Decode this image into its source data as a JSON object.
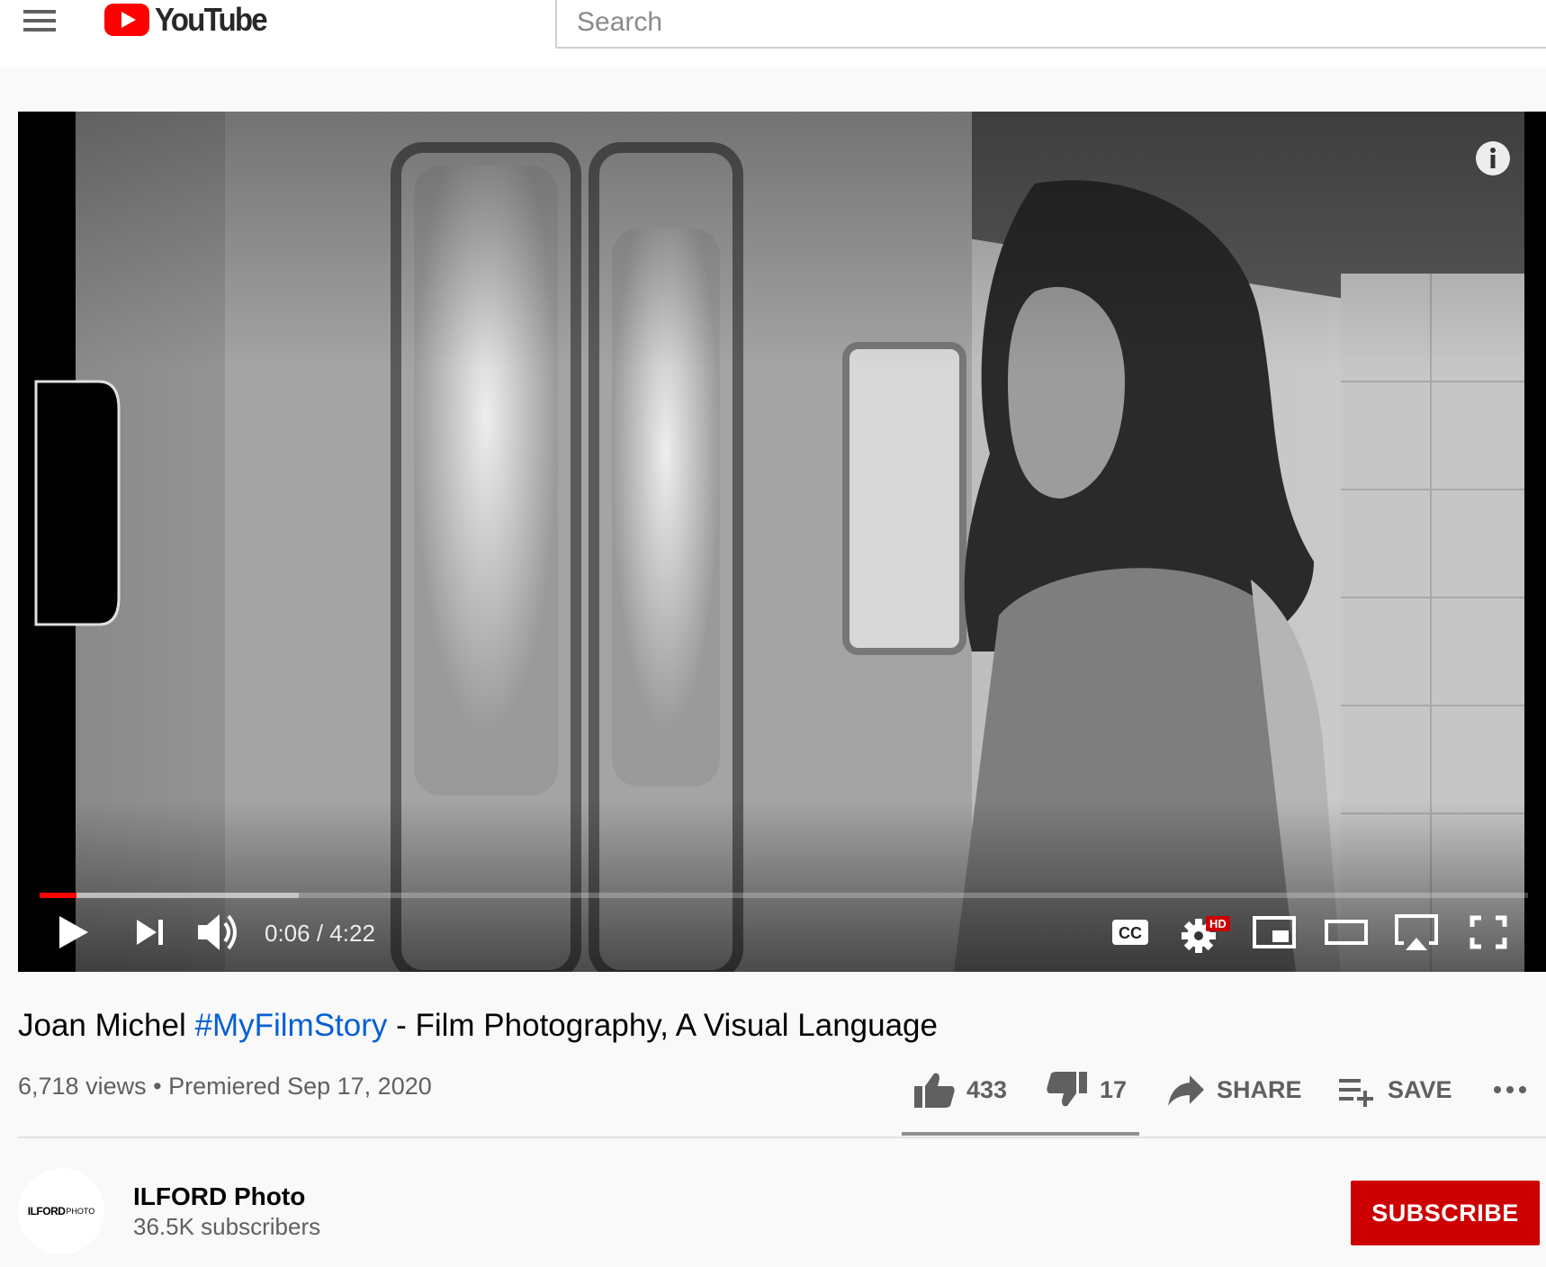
{
  "header": {
    "logo_text": "YouTube",
    "search_placeholder": "Search"
  },
  "player": {
    "current_time": "0:06",
    "duration": "4:22",
    "progress_played": 0.025,
    "progress_loaded": 0.174,
    "quality_badge": "HD"
  },
  "video": {
    "title_prefix": "Joan Michel ",
    "hashtag": "#MyFilmStory",
    "title_suffix": " - Film Photography, A Visual Language",
    "views": "6,718 views",
    "separator": " • ",
    "premiered": "Premiered Sep 17, 2020"
  },
  "actions": {
    "likes": "433",
    "dislikes": "17",
    "share_label": "SHARE",
    "save_label": "SAVE",
    "like_ratio": 0.962
  },
  "channel": {
    "avatar_text": "ILFORD",
    "avatar_subtext": "PHOTO",
    "name": "ILFORD Photo",
    "subscribers": "36.5K subscribers",
    "subscribe_label": "SUBSCRIBE"
  },
  "colors": {
    "brand_red": "#ff0000",
    "subscribe_red": "#cc0000",
    "link_blue": "#065fd4"
  }
}
